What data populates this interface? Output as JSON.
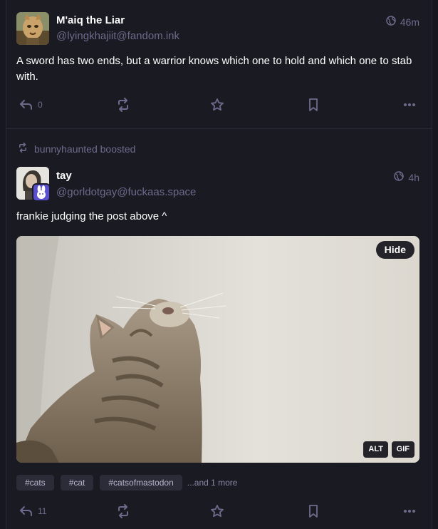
{
  "posts": [
    {
      "display_name": "M'aiq the Liar",
      "handle": "@lyingkhajiit@fandom.ink",
      "time": "46m",
      "content": "A sword has two ends, but a warrior knows which one to hold and which one to stab with.",
      "reply_count": "0"
    },
    {
      "boosted_by": "bunnyhaunted boosted",
      "display_name": "tay",
      "handle": "@gorldotgay@fuckaas.space",
      "time": "4h",
      "content": "frankie judging the post above ^",
      "media": {
        "hide_label": "Hide",
        "alt_label": "ALT",
        "gif_label": "GIF"
      },
      "tags": [
        "#cats",
        "#cat",
        "#catsofmastodon"
      ],
      "more_tags": "...and 1 more",
      "reply_count": "11"
    }
  ],
  "colors": {
    "background": "#1a1a22",
    "muted": "#6f6a8c",
    "tag_bg": "#2c2c38"
  }
}
